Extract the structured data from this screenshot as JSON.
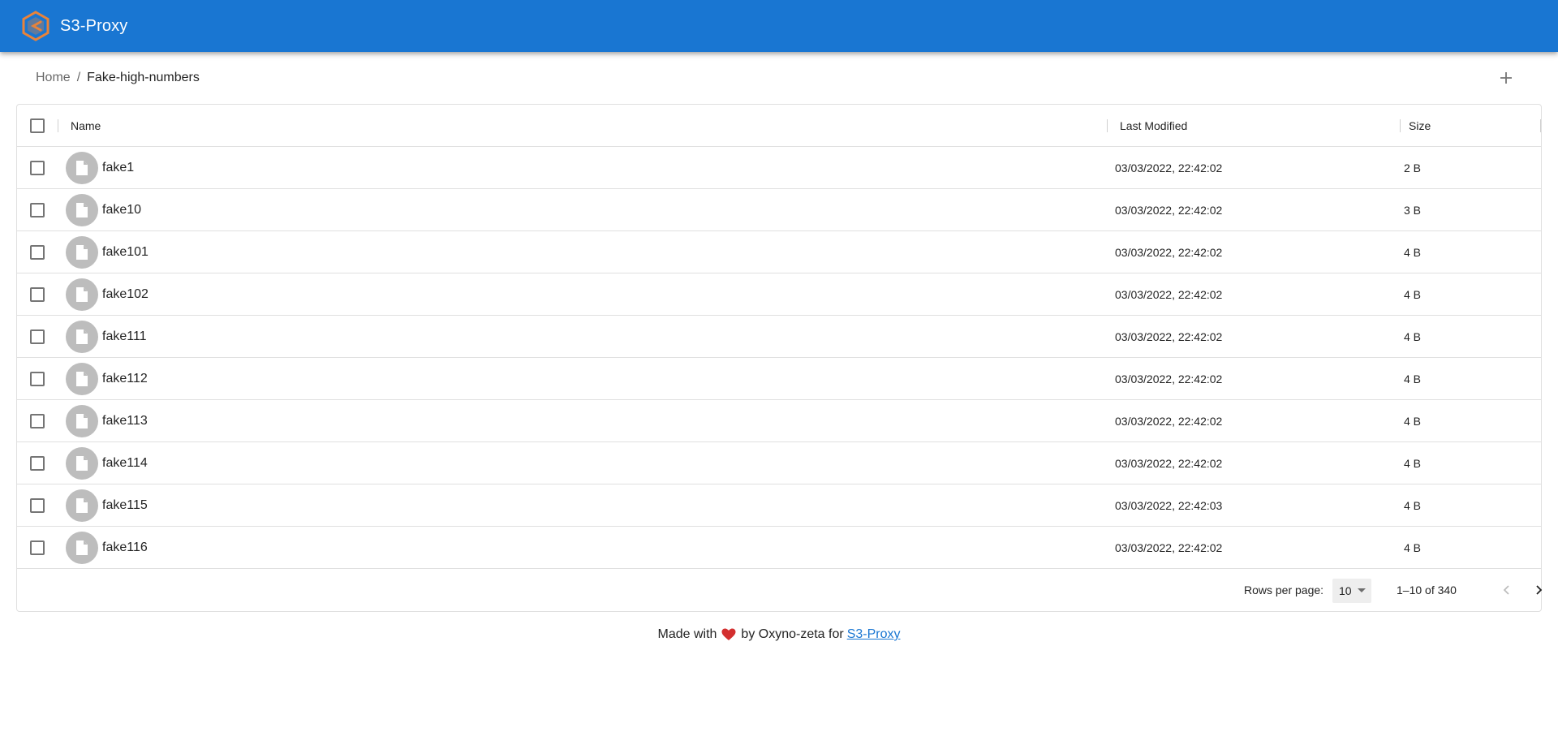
{
  "header": {
    "title": "S3-Proxy",
    "logo_icon": "s3-proxy-logo-icon",
    "background": "#1976d2"
  },
  "breadcrumb": {
    "home": "Home",
    "separator": "/",
    "current": "Fake-high-numbers"
  },
  "toolbar": {
    "add_icon": "plus-icon"
  },
  "table": {
    "columns": {
      "name": "Name",
      "last_modified": "Last Modified",
      "size": "Size"
    },
    "rows": [
      {
        "name": "fake1",
        "last_modified": "03/03/2022, 22:42:02",
        "size": "2 B"
      },
      {
        "name": "fake10",
        "last_modified": "03/03/2022, 22:42:02",
        "size": "3 B"
      },
      {
        "name": "fake101",
        "last_modified": "03/03/2022, 22:42:02",
        "size": "4 B"
      },
      {
        "name": "fake102",
        "last_modified": "03/03/2022, 22:42:02",
        "size": "4 B"
      },
      {
        "name": "fake111",
        "last_modified": "03/03/2022, 22:42:02",
        "size": "4 B"
      },
      {
        "name": "fake112",
        "last_modified": "03/03/2022, 22:42:02",
        "size": "4 B"
      },
      {
        "name": "fake113",
        "last_modified": "03/03/2022, 22:42:02",
        "size": "4 B"
      },
      {
        "name": "fake114",
        "last_modified": "03/03/2022, 22:42:02",
        "size": "4 B"
      },
      {
        "name": "fake115",
        "last_modified": "03/03/2022, 22:42:03",
        "size": "4 B"
      },
      {
        "name": "fake116",
        "last_modified": "03/03/2022, 22:42:02",
        "size": "4 B"
      }
    ],
    "row_icon": "file-icon"
  },
  "pagination": {
    "rows_per_page_label": "Rows per page:",
    "rows_per_page_value": "10",
    "range": "1–10 of 340"
  },
  "footer": {
    "made_with": "Made with",
    "by": "by Oxyno-zeta for",
    "link": "S3-Proxy",
    "heart_color": "#d32f2f"
  }
}
